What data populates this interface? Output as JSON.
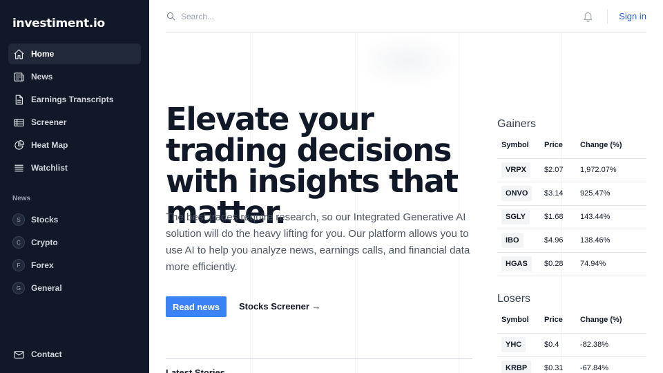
{
  "app": {
    "brand": "investiment.io"
  },
  "sidebar": {
    "main_items": [
      {
        "label": "Home",
        "icon": "home-icon",
        "active": true
      },
      {
        "label": "News",
        "icon": "newspaper-icon"
      },
      {
        "label": "Earnings Transcripts",
        "icon": "document-icon"
      },
      {
        "label": "Screener",
        "icon": "table-icon"
      },
      {
        "label": "Heat Map",
        "icon": "pie-chart-icon"
      },
      {
        "label": "Watchlist",
        "icon": "list-icon"
      }
    ],
    "news_section_label": "News",
    "news_items": [
      {
        "label": "Stocks",
        "badge": "S"
      },
      {
        "label": "Crypto",
        "badge": "C"
      },
      {
        "label": "Forex",
        "badge": "F"
      },
      {
        "label": "General",
        "badge": "G"
      }
    ],
    "contact": {
      "label": "Contact",
      "icon": "mail-icon"
    }
  },
  "header": {
    "search_placeholder": "Search...",
    "search_value": "",
    "signin_label": "Sign in"
  },
  "hero": {
    "title": "Elevate your trading decisions with insights that matter.",
    "body": "The best trades require research, so our Integrated Generative AI solution will do the heavy lifting for you. Our platform allows you to use AI to help you analyze news, earnings calls, and financial data more efficiently.",
    "primary_button": "Read news",
    "secondary_link": "Stocks Screener →",
    "section_label_partial": "Latest Stories"
  },
  "gainers": {
    "title": "Gainers",
    "columns": [
      "Symbol",
      "Price",
      "Change (%)"
    ],
    "rows": [
      {
        "symbol": "VRPX",
        "price": "$2.07",
        "change": "1,972.07%"
      },
      {
        "symbol": "ONVO",
        "price": "$3.14",
        "change": "925.47%"
      },
      {
        "symbol": "SGLY",
        "price": "$1.68",
        "change": "143.44%"
      },
      {
        "symbol": "IBO",
        "price": "$4.96",
        "change": "138.46%"
      },
      {
        "symbol": "HGAS",
        "price": "$0.28",
        "change": "74.94%"
      }
    ]
  },
  "losers": {
    "title": "Losers",
    "columns": [
      "Symbol",
      "Price",
      "Change (%)"
    ],
    "rows": [
      {
        "symbol": "YHC",
        "price": "$0.4",
        "change": "-82.38%"
      },
      {
        "symbol": "KRBP",
        "price": "$0.31",
        "change": "-67.84%"
      }
    ]
  },
  "colors": {
    "sidebar_bg": "#111827",
    "accent": "#3b82f6",
    "link": "#2563eb",
    "up": "#16a34a",
    "down": "#dc2626"
  }
}
